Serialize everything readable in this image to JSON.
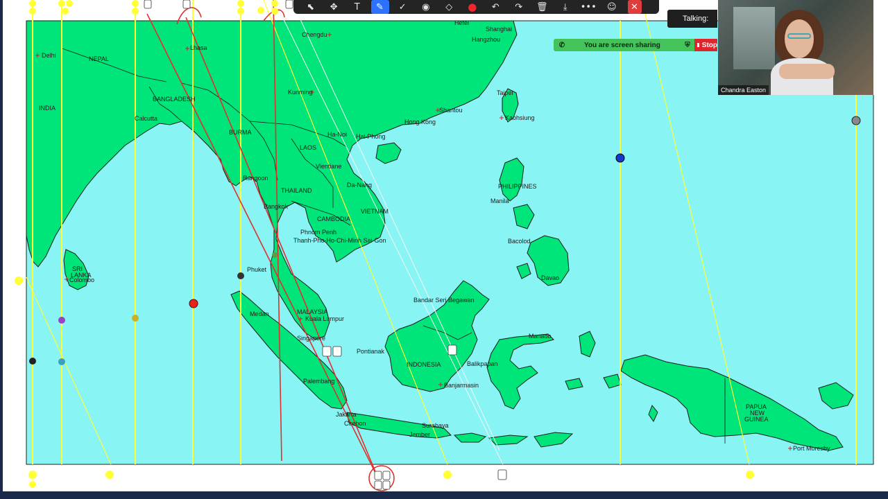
{
  "toolbar": {
    "tools": [
      {
        "name": "select-icon",
        "glyph": "⬉"
      },
      {
        "name": "move-icon",
        "glyph": "✥"
      },
      {
        "name": "text-icon",
        "glyph": "T"
      },
      {
        "name": "draw-icon",
        "glyph": "✎",
        "active": true
      },
      {
        "name": "stamp-icon",
        "glyph": "✓"
      },
      {
        "name": "spotlight-icon",
        "glyph": "◉"
      },
      {
        "name": "eraser-icon",
        "glyph": "◇"
      },
      {
        "name": "color-icon",
        "glyph": "●",
        "rec": true
      },
      {
        "name": "undo-icon",
        "glyph": "↶"
      },
      {
        "name": "redo-icon",
        "glyph": "↷"
      },
      {
        "name": "trash-icon",
        "glyph": "🗑"
      },
      {
        "name": "save-icon",
        "glyph": "⤓"
      },
      {
        "name": "more-icon",
        "glyph": "•••"
      },
      {
        "name": "request-icon",
        "glyph": "☺"
      }
    ],
    "close_glyph": "✕"
  },
  "talking_label": "Talking:",
  "sharing": {
    "text": "You are screen sharing",
    "stop_label": "Stop"
  },
  "participant": {
    "name": "Chandra Easton"
  },
  "colors": {
    "sea": "#88f4f4",
    "land": "#00e57a",
    "grid": "#ffff33",
    "line_red": "#e0302c",
    "line_white": "#f0f0f0"
  },
  "map": {
    "country_labels": [
      "NEPAL",
      "INDIA",
      "BANGLADESH",
      "BURMA",
      "LAOS",
      "THAILAND",
      "CAMBODIA",
      "VIETNAM",
      "SRI LANKA",
      "MALAYSIA",
      "INDONESIA",
      "PHILIPPINES",
      "PAPUA NEW GUINEA"
    ],
    "cities": [
      "Delhi",
      "Lhasa",
      "Chengdu",
      "Hefei",
      "Shanghai",
      "Hangzhou",
      "Kunming",
      "Taipei",
      "Shantou",
      "Kaohsiung",
      "Calcutta",
      "Hong Kong",
      "Ha-Noi",
      "Hai-Phong",
      "Vientiane",
      "Rangoon",
      "Da-Nang",
      "Bangkok",
      "Manila",
      "Phnom Penh",
      "Thanh-Pho-Ho-Chi-Minh Sai-Gon",
      "Bacolod",
      "Colombo",
      "Phuket",
      "Davao",
      "Bandar Seri Begawan",
      "Medan",
      "Kuala Lumpur",
      "Singapore",
      "Manado",
      "Pontianak",
      "Balikpapan",
      "Palembang",
      "Banjarmasin",
      "Jakarta",
      "Cirebon",
      "Surabaya",
      "Jember",
      "Port Moresby"
    ]
  }
}
